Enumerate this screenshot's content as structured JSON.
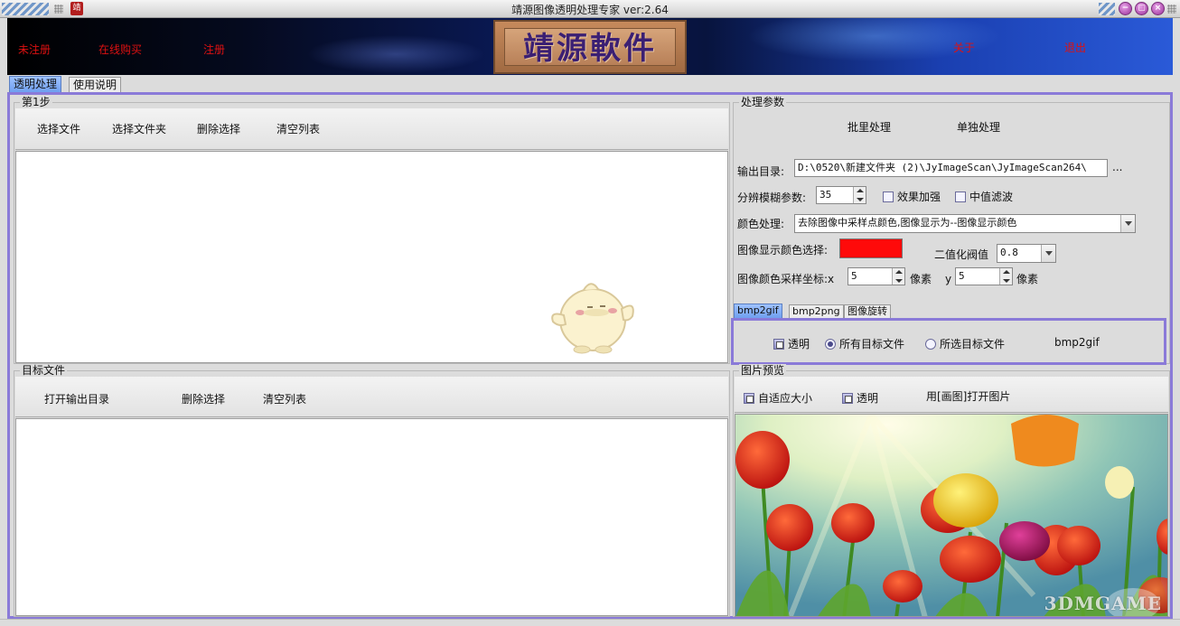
{
  "window": {
    "title": "靖源图像透明处理专家 ver:2.64",
    "app_icon_glyph": "靖"
  },
  "banner": {
    "unregistered": "未注册",
    "buy_online": "在线购买",
    "register": "注册",
    "logo_text": "靖源軟件",
    "about": "关于",
    "exit": "退出"
  },
  "main_tabs": [
    "透明处理",
    "使用说明"
  ],
  "step1": {
    "title": "第1步",
    "buttons": [
      "选择文件",
      "选择文件夹",
      "删除选择",
      "清空列表"
    ]
  },
  "target": {
    "title": "目标文件",
    "buttons": [
      "打开输出目录",
      "删除选择",
      "清空列表"
    ]
  },
  "params": {
    "title": "处理参数",
    "batch": "批里处理",
    "single": "单独处理",
    "output_label": "输出目录:",
    "output_value": "D:\\0520\\新建文件夹 (2)\\JyImageScan\\JyImageScan264\\",
    "browse": "...",
    "blur_label": "分辨模糊参数:",
    "blur_value": "35",
    "enhance": "效果加强",
    "median": "中值滤波",
    "color_label": "颜色处理:",
    "color_value": "去除图像中采样点颜色,图像显示为--图像显示颜色",
    "display_color_label": "图像显示颜色选择:",
    "display_color": "#ff0a0a",
    "threshold_label": "二值化阀值",
    "threshold_value": "0.8",
    "coord_label": "图像颜色采样坐标:x",
    "x_value": "5",
    "pixel_unit": "像素",
    "y_label": "y",
    "y_value": "5"
  },
  "sub_tabs": [
    "bmp2gif",
    "bmp2png",
    "图像旋转"
  ],
  "bmp2gif": {
    "transparent": "透明",
    "all_targets": "所有目标文件",
    "selected_targets": "所选目标文件",
    "run": "bmp2gif"
  },
  "preview": {
    "title": "图片预览",
    "fit": "自适应大小",
    "transparent": "透明",
    "open_in_paint": "用[画图]打开图片",
    "watermark": "3DMGAME"
  }
}
